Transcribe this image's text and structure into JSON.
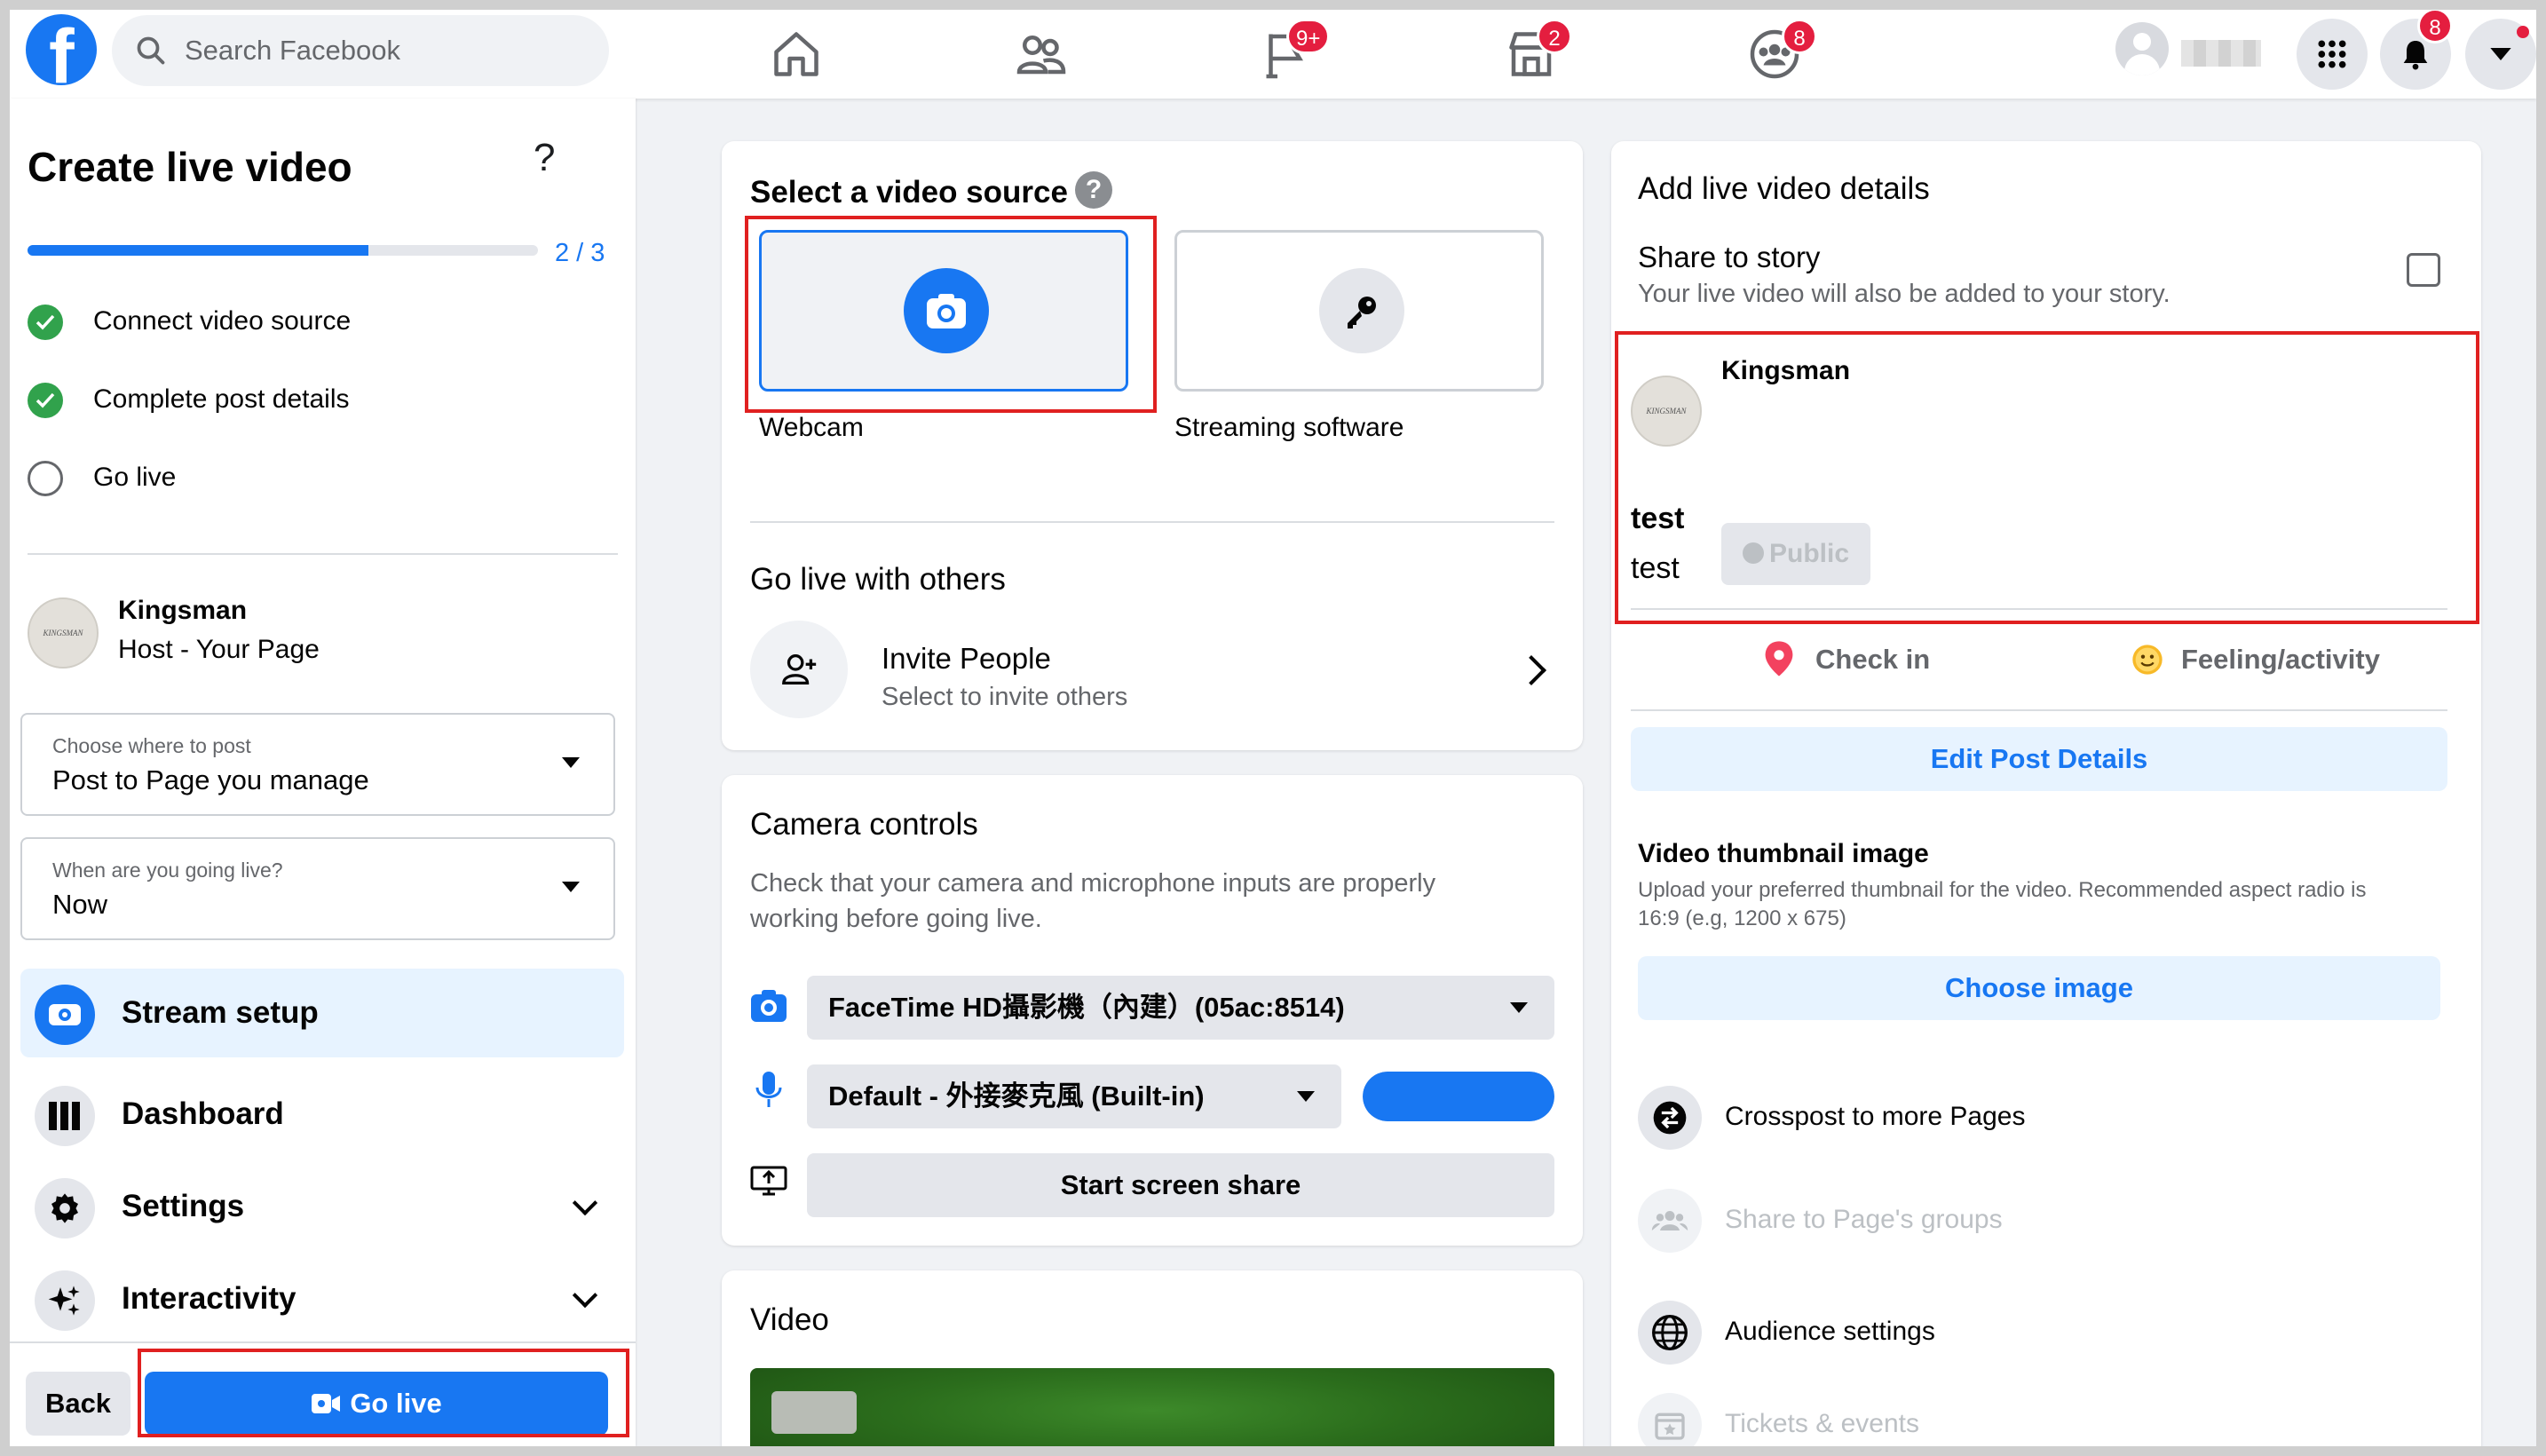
{
  "topbar": {
    "search_placeholder": "Search Facebook",
    "badges": {
      "pages": "9+",
      "marketplace": "2",
      "groups": "8",
      "notifications": "8"
    }
  },
  "left": {
    "title": "Create live video",
    "help": "?",
    "progress": {
      "label": "2 / 3",
      "fraction": 0.667
    },
    "steps": [
      {
        "label": "Connect video source",
        "done": true
      },
      {
        "label": "Complete post details",
        "done": true
      },
      {
        "label": "Go live",
        "done": false
      }
    ],
    "host": {
      "name": "Kingsman",
      "role": "Host - Your Page",
      "logo_text": "KINGSMAN"
    },
    "post_where": {
      "label": "Choose where to post",
      "value": "Post to Page you manage"
    },
    "when": {
      "label": "When are you going live?",
      "value": "Now"
    },
    "menu": [
      {
        "label": "Stream setup",
        "icon": "camera-icon",
        "active": true
      },
      {
        "label": "Dashboard",
        "icon": "bars-icon",
        "active": false
      },
      {
        "label": "Settings",
        "icon": "gear-icon",
        "active": false
      },
      {
        "label": "Interactivity",
        "icon": "sparkle-icon",
        "active": false
      }
    ],
    "back_label": "Back",
    "golive_label": "Go live"
  },
  "source": {
    "title": "Select a video source",
    "webcam": "Webcam",
    "software": "Streaming software",
    "others_title": "Go live with others",
    "invite_title": "Invite People",
    "invite_sub": "Select to invite others"
  },
  "camera": {
    "title": "Camera controls",
    "desc_line1": "Check that your camera and microphone inputs are properly",
    "desc_line2": "working before going live.",
    "camera_device": "FaceTime HD攝影機（內建）(05ac:8514)",
    "mic_device": "Default - 外接麥克風 (Built-in)",
    "mic_level": 1.0,
    "screen_share": "Start screen share"
  },
  "video": {
    "title": "Video"
  },
  "details": {
    "title": "Add live video details",
    "story_title": "Share to story",
    "story_desc": "Your live video will also be added to your story.",
    "page_name": "Kingsman",
    "privacy": "Public",
    "post_title": "test",
    "post_body": "test",
    "checkin": "Check in",
    "feeling": "Feeling/activity",
    "edit_btn": "Edit Post Details",
    "thumb_title": "Video thumbnail image",
    "thumb_desc1": "Upload your preferred thumbnail for the video. Recommended aspect radio is",
    "thumb_desc2": "16:9 (e.g, 1200 x 675)",
    "choose_btn": "Choose image",
    "rows": [
      {
        "label": "Crosspost to more Pages",
        "enabled": true
      },
      {
        "label": "Share to Page's groups",
        "enabled": false
      },
      {
        "label": "Audience settings",
        "enabled": true
      },
      {
        "label": "Tickets & events",
        "enabled": false
      }
    ]
  },
  "colors": {
    "brand": "#1877f2",
    "highlight": "#e02020",
    "success": "#31a24c"
  }
}
